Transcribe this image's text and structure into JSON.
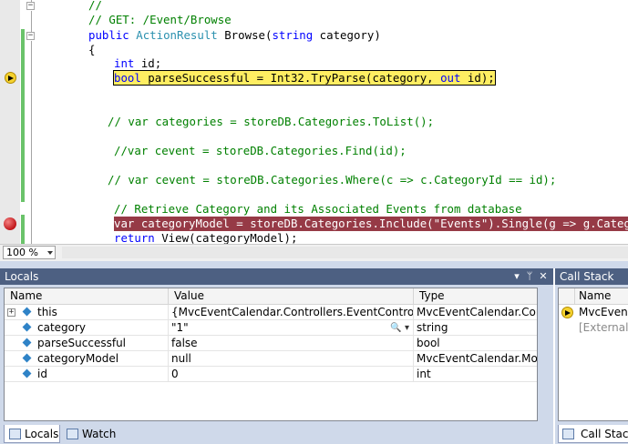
{
  "editor": {
    "lines": {
      "l0": "//",
      "l1": "// GET: /Event/Browse",
      "l2_kw": "public",
      "l2_type": "ActionResult",
      "l2_rest": " Browse(",
      "l2_kw2": "string",
      "l2_end": " category)",
      "l3": "{",
      "l4_kw": "int",
      "l4_rest": " id;",
      "l5_kw": "bool",
      "l5_rest": " parseSuccessful = Int32.TryParse(category, ",
      "l5_kw2": "out",
      "l5_end": " id);",
      "l6": "// var categories = storeDB.Categories.ToList();",
      "l7": "//var cevent = storeDB.Categories.Find(id);",
      "l8": "// var cevent = storeDB.Categories.Where(c => c.CategoryId == id);",
      "l9": "// Retrieve Category and its Associated Events from database",
      "l10": "var categoryModel = storeDB.Categories.Include(\"Events\").Single(g => g.CategoryId == id);",
      "l11_kw": "return",
      "l11_rest": " View(categoryModel);"
    },
    "zoom": "100 %"
  },
  "locals": {
    "title": "Locals",
    "pin_glyph": "▾",
    "pushpin_glyph": "ᛘ",
    "close_glyph": "✕",
    "columns": {
      "name": "Name",
      "value": "Value",
      "type": "Type"
    },
    "rows": [
      {
        "name": "this",
        "value": "{MvcEventCalendar.Controllers.EventController}",
        "type": "MvcEventCalendar.Contr",
        "expandable": true
      },
      {
        "name": "category",
        "value": "\"1\"",
        "type": "string"
      },
      {
        "name": "parseSuccessful",
        "value": "false",
        "type": "bool"
      },
      {
        "name": "categoryModel",
        "value": "null",
        "type": "MvcEventCalendar.Mode"
      },
      {
        "name": "id",
        "value": "0",
        "type": "int"
      }
    ],
    "magnifier_glyph": "🔍 ▾",
    "tabs": {
      "locals": "Locals",
      "watch": "Watch"
    }
  },
  "callstack": {
    "title": "Call Stack",
    "column": "Name",
    "rows": [
      {
        "text": "MvcEventCalen"
      },
      {
        "text": "[External Code]"
      }
    ],
    "tab": "Call Stack"
  },
  "colors": {
    "title_bar": "#4d6082",
    "pane_bg": "#cfd9ea",
    "current_line": "#ffee62",
    "breakpoint_line": "#963a46",
    "keyword": "#0000ff",
    "comment": "#008000",
    "type": "#2b91af"
  }
}
